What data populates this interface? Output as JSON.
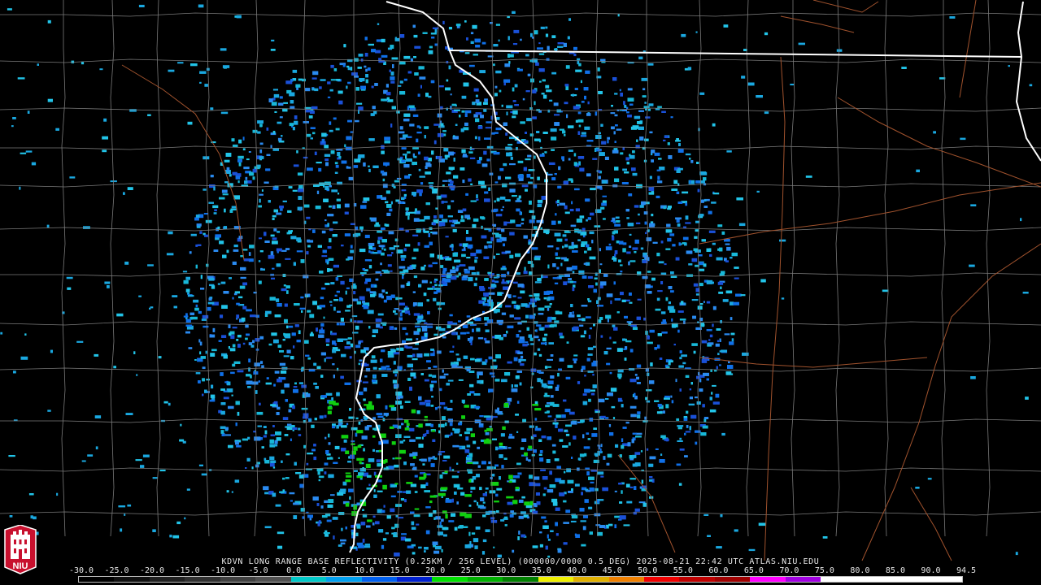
{
  "caption": "KDVN LONG RANGE BASE REFLECTIVITY (0.25KM / 256 LEVEL) (000000/0000 0.5 DEG) 2025-08-21 22:42 UTC  ATLAS.NIU.EDU",
  "logo_text": "NIU",
  "scale": {
    "labels": [
      "-30.0",
      "-25.0",
      "-20.0",
      "-15.0",
      "-10.0",
      "-5.0",
      "0.0",
      "5.0",
      "10.0",
      "15.0",
      "20.0",
      "25.0",
      "30.0",
      "35.0",
      "40.0",
      "45.0",
      "50.0",
      "55.0",
      "60.0",
      "65.0",
      "70.0",
      "75.0",
      "80.0",
      "85.0",
      "90.0",
      "94.5"
    ],
    "colors": [
      "#000000",
      "#101010",
      "#202020",
      "#303030",
      "#404040",
      "#505050",
      "#00c8c8",
      "#00a0f0",
      "#0060f0",
      "#0020d0",
      "#00e000",
      "#00b000",
      "#008000",
      "#f0f000",
      "#e0b000",
      "#f08000",
      "#f00000",
      "#c00000",
      "#a00000",
      "#ff00ff",
      "#a000e0",
      "#ffffff",
      "#ffffff",
      "#ffffff",
      "#ffffff"
    ]
  },
  "map": {
    "radar_site": "KDVN",
    "state_border_color": "#ffffff",
    "county_line_color": "#7a7a7a",
    "road_color": "#a0522d"
  }
}
